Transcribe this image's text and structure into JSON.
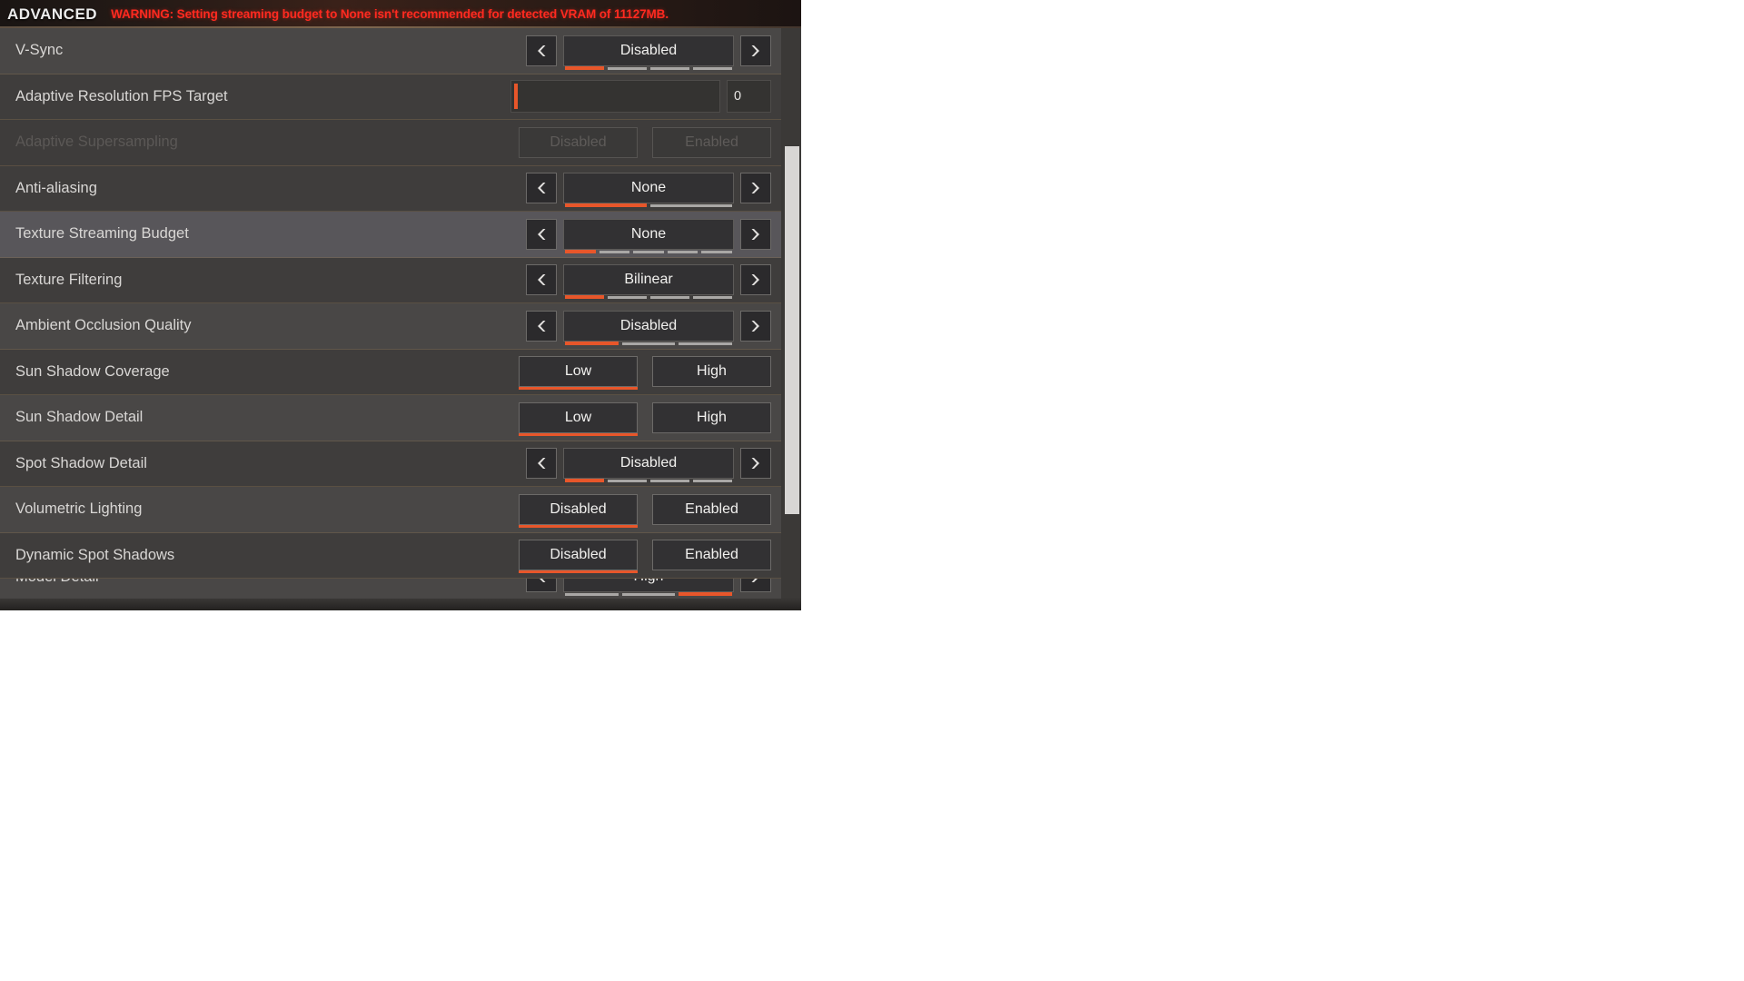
{
  "header": {
    "title": "ADVANCED",
    "warning": "WARNING: Setting streaming budget to None isn't recommended for detected VRAM of 11127MB.",
    "warning_color": "#ff2a20"
  },
  "theme": {
    "accent": "#e8562a",
    "panel_bg": "#3b3937",
    "row_bg": "#494746",
    "row_selected_bg": "#58565a",
    "text": "#d9d7d5"
  },
  "controls": {
    "prev_icon": "chevron-left-icon",
    "next_icon": "chevron-right-icon"
  },
  "settings": [
    {
      "name": "V-Sync",
      "type": "stepper",
      "value": "Disabled",
      "segments": 4,
      "active_segment": 1
    },
    {
      "name": "Adaptive Resolution FPS Target",
      "type": "slider",
      "value": "0",
      "slider_percent": 0
    },
    {
      "name": "Adaptive Supersampling",
      "type": "toggle",
      "disabled": true,
      "options": [
        "Disabled",
        "Enabled"
      ],
      "selected": "Disabled"
    },
    {
      "name": "Anti-aliasing",
      "type": "stepper",
      "value": "None",
      "segments": 2,
      "active_segment": 1
    },
    {
      "name": "Texture Streaming Budget",
      "type": "stepper",
      "value": "None",
      "segments": 5,
      "active_segment": 1,
      "selected_row": true
    },
    {
      "name": "Texture Filtering",
      "type": "stepper",
      "value": "Bilinear",
      "segments": 4,
      "active_segment": 1
    },
    {
      "name": "Ambient Occlusion Quality",
      "type": "stepper",
      "value": "Disabled",
      "segments": 3,
      "active_segment": 1
    },
    {
      "name": "Sun Shadow Coverage",
      "type": "toggle",
      "options": [
        "Low",
        "High"
      ],
      "selected": "Low"
    },
    {
      "name": "Sun Shadow Detail",
      "type": "toggle",
      "options": [
        "Low",
        "High"
      ],
      "selected": "Low"
    },
    {
      "name": "Spot Shadow Detail",
      "type": "stepper",
      "value": "Disabled",
      "segments": 4,
      "active_segment": 1
    },
    {
      "name": "Volumetric Lighting",
      "type": "toggle",
      "options": [
        "Disabled",
        "Enabled"
      ],
      "selected": "Disabled"
    },
    {
      "name": "Dynamic Spot Shadows",
      "type": "toggle",
      "options": [
        "Disabled",
        "Enabled"
      ],
      "selected": "Disabled"
    },
    {
      "name": "Model Detail",
      "type": "stepper",
      "value": "High",
      "segments": 3,
      "active_segment": 3,
      "partial": true
    }
  ]
}
